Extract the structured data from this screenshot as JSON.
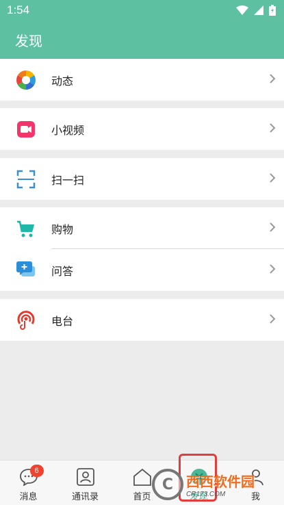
{
  "status_bar": {
    "time": "1:54"
  },
  "header": {
    "title": "发现"
  },
  "menu": {
    "moments": "动态",
    "short_video": "小视频",
    "scan": "扫一扫",
    "shopping": "购物",
    "qa": "问答",
    "radio": "电台"
  },
  "tabbar": {
    "messages": {
      "label": "消息",
      "badge": "6"
    },
    "contacts": {
      "label": "通讯录"
    },
    "home": {
      "label": "首页"
    },
    "discover": {
      "label": "发现"
    },
    "me": {
      "label": "我"
    }
  },
  "watermark": {
    "main": "西西软件园",
    "sub": "CR173.COM",
    "mark": "C"
  },
  "colors": {
    "header": "#5cc0a1",
    "background": "#ececec",
    "highlight": "#e33c3c",
    "badge": "#f0432f"
  }
}
